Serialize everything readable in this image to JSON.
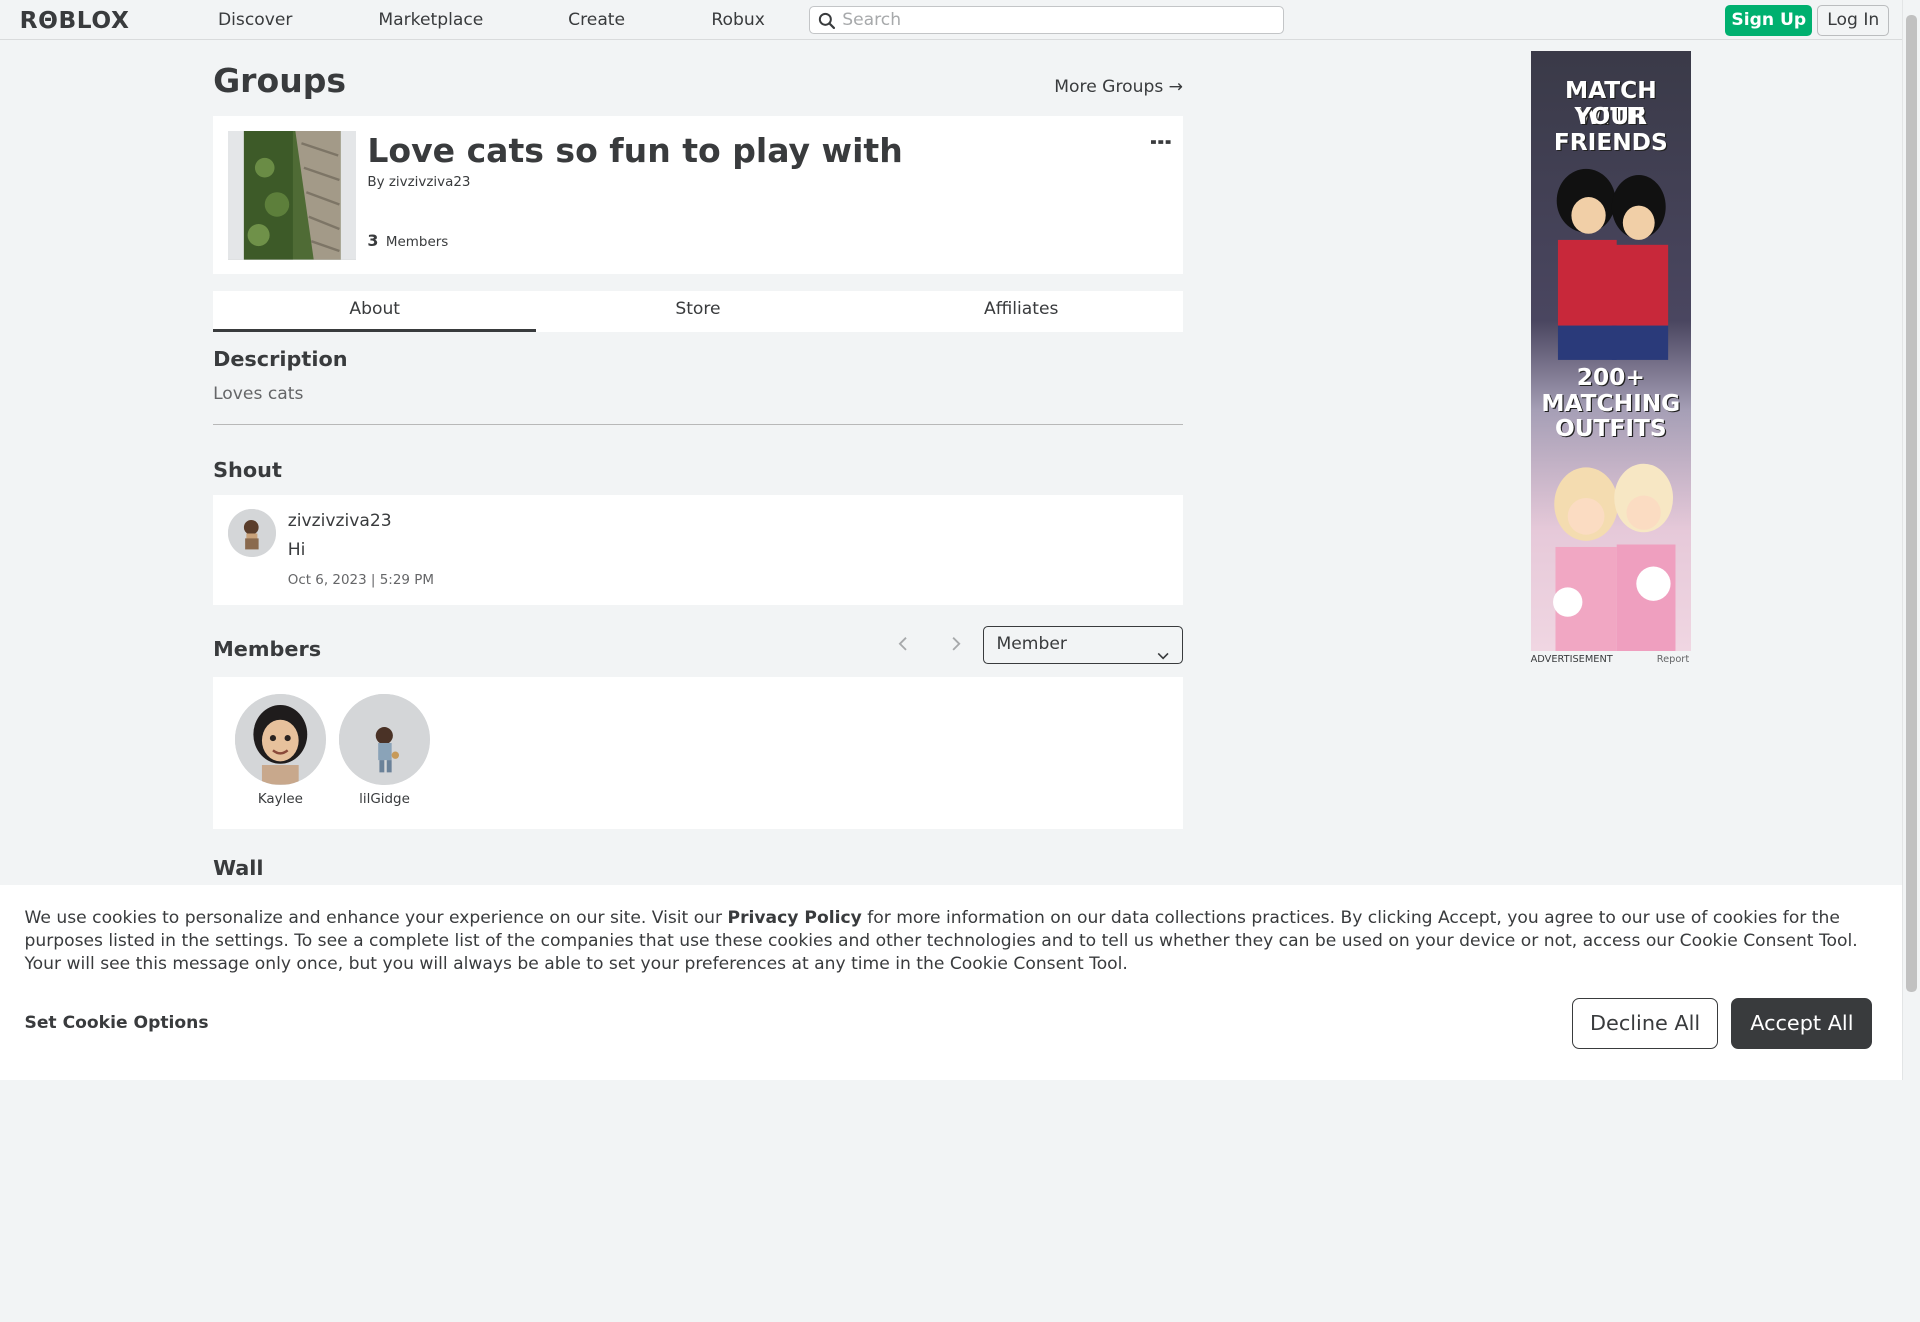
{
  "nav": {
    "logo": "RΘBLOX",
    "items": [
      "Discover",
      "Marketplace",
      "Create",
      "Robux"
    ],
    "search_placeholder": "Search",
    "signup": "Sign Up",
    "login": "Log In"
  },
  "page": {
    "title": "Groups",
    "more_groups": "More Groups →"
  },
  "group": {
    "name": "Love cats so fun to play with",
    "by_prefix": "By",
    "owner": "zivzivziva23",
    "member_count": "3",
    "members_label": "Members"
  },
  "tabs": [
    "About",
    "Store",
    "Affiliates"
  ],
  "description": {
    "heading": "Description",
    "text": "Loves cats"
  },
  "shout": {
    "heading": "Shout",
    "user": "zivzivziva23",
    "body": "Hi",
    "date": "Oct 6, 2023 | 5:29 PM"
  },
  "members": {
    "heading": "Members",
    "role_selected": "Member",
    "list": [
      {
        "name": "Kaylee"
      },
      {
        "name": "lilGidge"
      }
    ]
  },
  "wall": {
    "heading": "Wall"
  },
  "ad": {
    "line1": "MATCH WITH",
    "line2": "YOUR",
    "line3": "FRIENDS",
    "line4": "200+",
    "line5": "MATCHING",
    "line6": "OUTFITS",
    "label": "ADVERTISEMENT",
    "report": "Report"
  },
  "cookie": {
    "text_before": "We use cookies to personalize and enhance your experience on our site. Visit our ",
    "policy_link": "Privacy Policy",
    "text_after": " for more information on our data collections practices. By clicking Accept, you agree to our use of cookies for the purposes listed in the settings. To see a complete list of the companies that use these cookies and other technologies and to tell us whether they can be used on your device or not, access our Cookie Consent Tool. Your will see this message only once, but you will always be able to set your preferences at any time in the Cookie Consent Tool.",
    "set_options": "Set Cookie Options",
    "decline": "Decline All",
    "accept": "Accept All"
  },
  "colors": {
    "signup_green": "#00b06f",
    "dark": "#393b3d",
    "background": "#f2f4f5"
  }
}
